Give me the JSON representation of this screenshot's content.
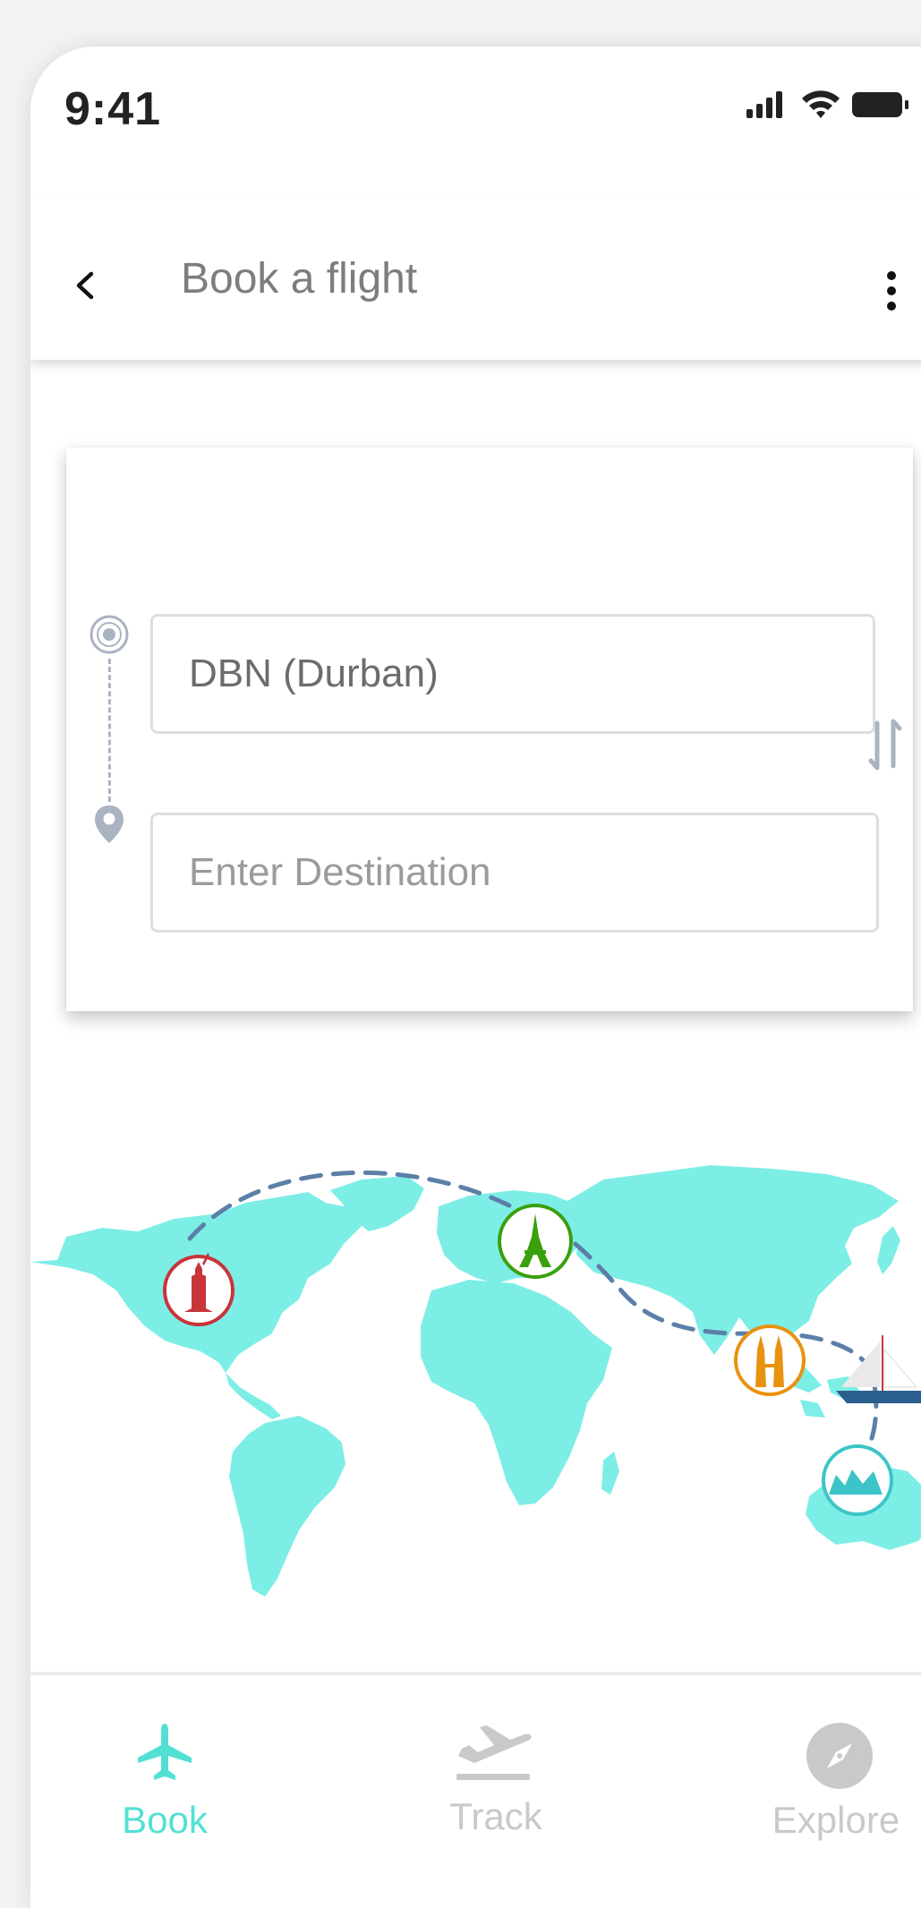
{
  "status_bar": {
    "time": "9:41"
  },
  "header": {
    "title": "Book a flight"
  },
  "booking": {
    "origin_value": "DBN (Durban)",
    "destination_placeholder": "Enter Destination"
  },
  "bottom_nav": {
    "items": [
      {
        "label": "Book",
        "icon": "plane-icon",
        "active": true
      },
      {
        "label": "Track",
        "icon": "departure-icon",
        "active": false
      },
      {
        "label": "Explore",
        "icon": "compass-icon",
        "active": false
      }
    ]
  },
  "colors": {
    "accent": "#52e0d4",
    "map_land": "#7deee6",
    "route": "#5b7fa8",
    "landmark_new_york": "#c7343a",
    "landmark_paris": "#3aa00e",
    "landmark_kuala_lumpur": "#e8920f",
    "landmark_sydney": "#3cc4c8",
    "inactive": "#c9c9c9"
  }
}
